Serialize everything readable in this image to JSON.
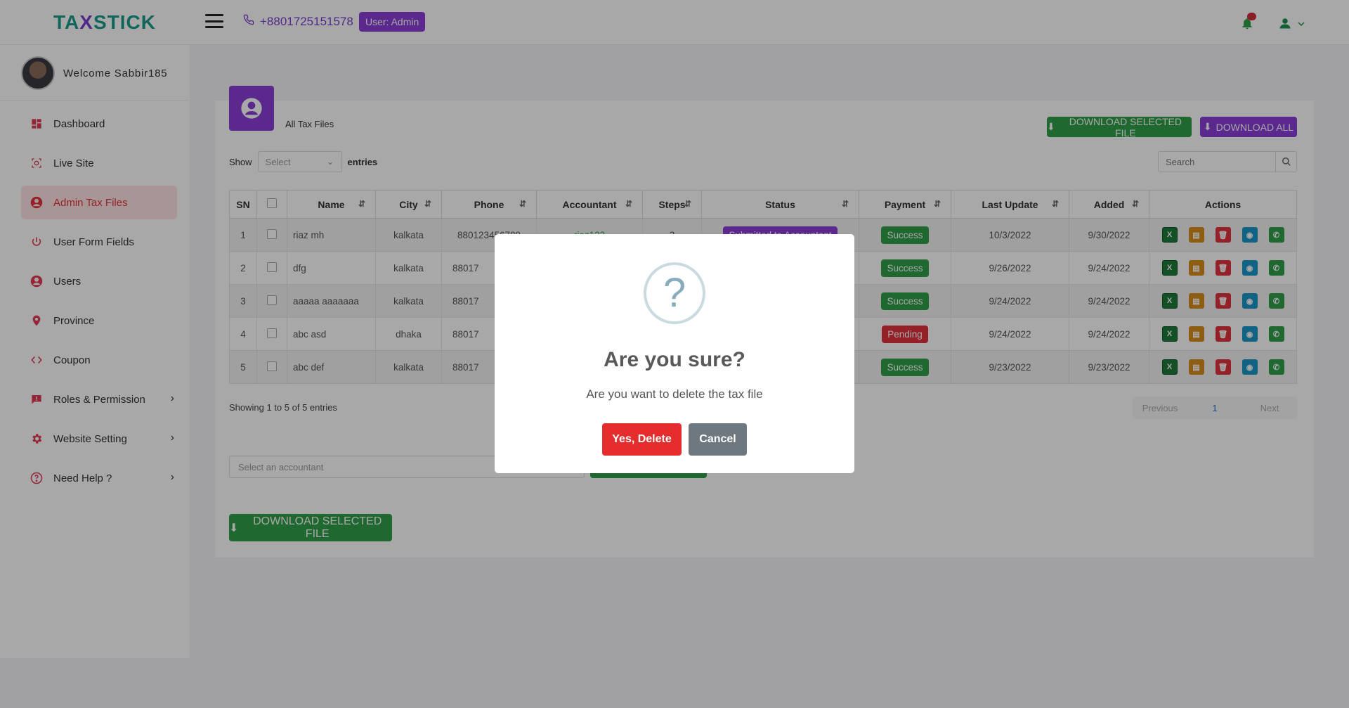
{
  "header": {
    "logo_prefix": "TA",
    "logo_x": "X",
    "logo_suffix": "STICK",
    "phone": "+8801725151578",
    "user_badge": "User:  Admin"
  },
  "sidebar": {
    "welcome": "Welcome Sabbir185",
    "items": [
      {
        "label": "Dashboard",
        "icon": "dashboard-icon",
        "active": false,
        "submenu": false
      },
      {
        "label": "Live Site",
        "icon": "camera-icon",
        "active": false,
        "submenu": false
      },
      {
        "label": "Admin Tax Files",
        "icon": "user-circle-icon",
        "active": true,
        "submenu": false
      },
      {
        "label": "User Form Fields",
        "icon": "power-icon",
        "active": false,
        "submenu": false
      },
      {
        "label": "Users",
        "icon": "user-circle-icon",
        "active": false,
        "submenu": false
      },
      {
        "label": "Province",
        "icon": "map-pin-icon",
        "active": false,
        "submenu": false
      },
      {
        "label": "Coupon",
        "icon": "code-icon",
        "active": false,
        "submenu": false
      },
      {
        "label": "Roles & Permission",
        "icon": "alert-message-icon",
        "active": false,
        "submenu": true
      },
      {
        "label": "Website Setting",
        "icon": "gear-icon",
        "active": false,
        "submenu": true
      },
      {
        "label": "Need Help ?",
        "icon": "help-circle-icon",
        "active": false,
        "submenu": true
      }
    ]
  },
  "main": {
    "title": "All Tax Files",
    "download_selected": "DOWNLOAD SELECTED FILE",
    "download_all": "DOWNLOAD ALL",
    "show_label": "Show",
    "select_placeholder": "Select",
    "entries_label": "entries",
    "search_placeholder": "Search",
    "columns": [
      "SN",
      "",
      "Name",
      "City",
      "Phone",
      "Accountant",
      "Steps",
      "Status",
      "Payment",
      "Last Update",
      "Added",
      "Actions"
    ],
    "rows": [
      {
        "sn": "1",
        "name": "riaz mh",
        "city": "kalkata",
        "phone": "880123456789",
        "accountant": "riaz123",
        "steps": "3",
        "status": "Submitted to Accountant",
        "payment": "Success",
        "last_update": "10/3/2022",
        "added": "9/30/2022"
      },
      {
        "sn": "2",
        "name": "dfg",
        "city": "kalkata",
        "phone": "88017",
        "accountant": "",
        "steps": "",
        "status": "",
        "payment": "Success",
        "last_update": "9/26/2022",
        "added": "9/24/2022"
      },
      {
        "sn": "3",
        "name": "aaaaa aaaaaaa",
        "city": "kalkata",
        "phone": "88017",
        "accountant": "",
        "steps": "",
        "status": "",
        "payment": "Success",
        "last_update": "9/24/2022",
        "added": "9/24/2022"
      },
      {
        "sn": "4",
        "name": "abc asd",
        "city": "dhaka",
        "phone": "88017",
        "accountant": "",
        "steps": "",
        "status": "",
        "payment": "Pending",
        "last_update": "9/24/2022",
        "added": "9/24/2022"
      },
      {
        "sn": "5",
        "name": "abc def",
        "city": "kalkata",
        "phone": "88017",
        "accountant": "",
        "steps": "",
        "status": "",
        "payment": "Success",
        "last_update": "9/23/2022",
        "added": "9/23/2022"
      }
    ],
    "showing_text": "Showing 1 to 5 of 5 entries",
    "pager": {
      "prev": "Previous",
      "current": "1",
      "next": "Next"
    },
    "accountant_placeholder": "Select an accountant",
    "download_selected_bottom": "DOWNLOAD SELECTED FILE"
  },
  "modal": {
    "icon": "?",
    "title": "Are you sure?",
    "text": "Are you want to delete the tax file",
    "confirm": "Yes, Delete",
    "cancel": "Cancel"
  },
  "colors": {
    "brand_purple": "#8a3ed6",
    "success_green": "#2f9e49",
    "danger_red": "#e0323c",
    "confirm_red": "#e62d2d",
    "cancel_gray": "#6e7881"
  }
}
